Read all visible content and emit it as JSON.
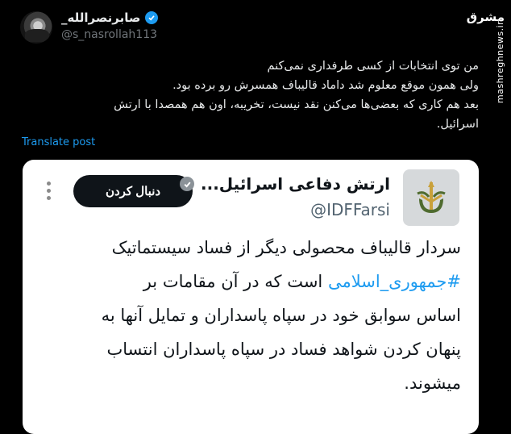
{
  "author": {
    "display_name": "صابرنصرالله_",
    "handle": "@s_nasrollah113"
  },
  "watermark": {
    "logo_text": "مشرق",
    "site": "mashreghnews.ir"
  },
  "tweet": {
    "lines": [
      "من توی انتخابات از کسی طرفداری نمی‌کنم",
      "ولی همون موقع معلوم شد داماد قالیباف همسرش رو برده بود.",
      "بعد هم کاری که بعضی‌ها می‌کنن نقد نیست، تخریبه، اون هم همصدا با ارتش",
      "اسرائیل."
    ],
    "translate_label": "Translate post"
  },
  "quoted": {
    "name": "ارتش دفاعی اسرائیل...",
    "handle": "@IDFFarsi",
    "follow_label": "دنبال کردن",
    "line1": "سردار قالیباف محصولی دیگر از فساد سیستماتیک",
    "hashtag": "#جمهوری_اسلامی",
    "line2_rest": " است که در آن مقامات بر",
    "line3": "اساس سوابق خود در سپاه پاسداران و تمایل آنها به",
    "line4": "پنهان کردن شواهد فساد در سپاه پاسداران انتساب",
    "line5": "میشوند."
  }
}
